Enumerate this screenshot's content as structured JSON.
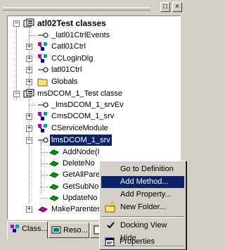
{
  "titlebar": {
    "pin_glyph": "□",
    "close_glyph": "×"
  },
  "tree": {
    "nodes": [
      {
        "label": "atl02Test classes",
        "type": "project"
      },
      {
        "label": "_latl01CtrlEvents",
        "type": "interface"
      },
      {
        "label": "Catl01Ctrl",
        "type": "class"
      },
      {
        "label": "CCLoginDlg",
        "type": "class"
      },
      {
        "label": "latl01Ctrl",
        "type": "interface"
      },
      {
        "label": "Globals",
        "type": "folder"
      },
      {
        "label": "msDCOM_1_Test classe",
        "type": "project"
      },
      {
        "label": "_lmsDCOM_1_srvEv",
        "type": "interface"
      },
      {
        "label": "CmsDCOM_1_srv",
        "type": "class"
      },
      {
        "label": "CServiceModule",
        "type": "class"
      },
      {
        "label": "lmsDCOM_1_srv",
        "type": "interface"
      },
      {
        "label": "AddNode(I",
        "type": "method"
      },
      {
        "label": "DeleteNo",
        "type": "method"
      },
      {
        "label": "GetAllPare",
        "type": "method"
      },
      {
        "label": "GetSubNo",
        "type": "method"
      },
      {
        "label": "UpdateNo",
        "type": "method"
      },
      {
        "label": "MakeParentes",
        "type": "function"
      }
    ]
  },
  "tabs": [
    {
      "label": "Class...",
      "icon": "class-view-icon"
    },
    {
      "label": "Reso...",
      "icon": "resource-view-icon"
    },
    {
      "label": "",
      "icon": "file-view-icon"
    }
  ],
  "menu": {
    "items": [
      {
        "label": "Go to Definition",
        "icon": ""
      },
      {
        "label": "Add Method...",
        "icon": ""
      },
      {
        "label": "Add Property...",
        "icon": ""
      },
      {
        "label": "New Folder...",
        "icon": "new-folder-icon"
      },
      {
        "label": "Docking View",
        "icon": "check-icon"
      },
      {
        "label": "Hide",
        "icon": ""
      },
      {
        "label": "Properties",
        "icon": "properties-icon"
      }
    ]
  },
  "colors": {
    "selection": "#0a246a",
    "face": "#d4d0c8"
  }
}
